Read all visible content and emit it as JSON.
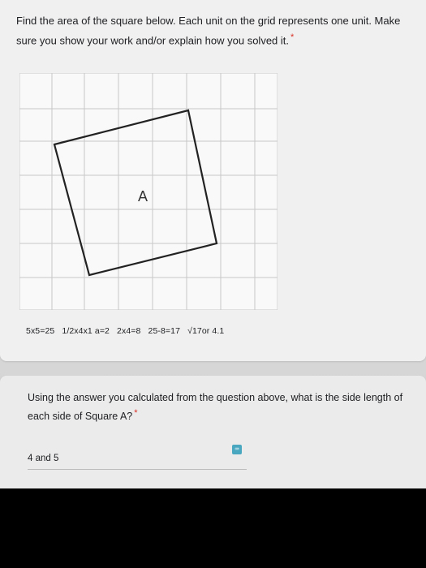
{
  "question1": {
    "title": "Find the area of the square below. Each unit on the grid represents one unit. Make sure you show your work and/or explain how you solved it.",
    "required_mark": "*",
    "figure": {
      "square_label": "A",
      "grid_color": "#c8c8c8",
      "square_stroke": "#222222"
    },
    "work_text": "5x5=25   1/2x4x1 a=2   2x4=8   25-8=17   √17or 4.1"
  },
  "question2": {
    "title": "Using the answer you calculated from the question above, what is the side length of each side of Square A?",
    "required_mark": "*",
    "answer_value": "4 and 5",
    "extension_icon": "keyboard-extension-icon"
  },
  "colors": {
    "required": "#d93025",
    "text": "#202124",
    "extension_icon_bg": "#4aa7c0"
  }
}
